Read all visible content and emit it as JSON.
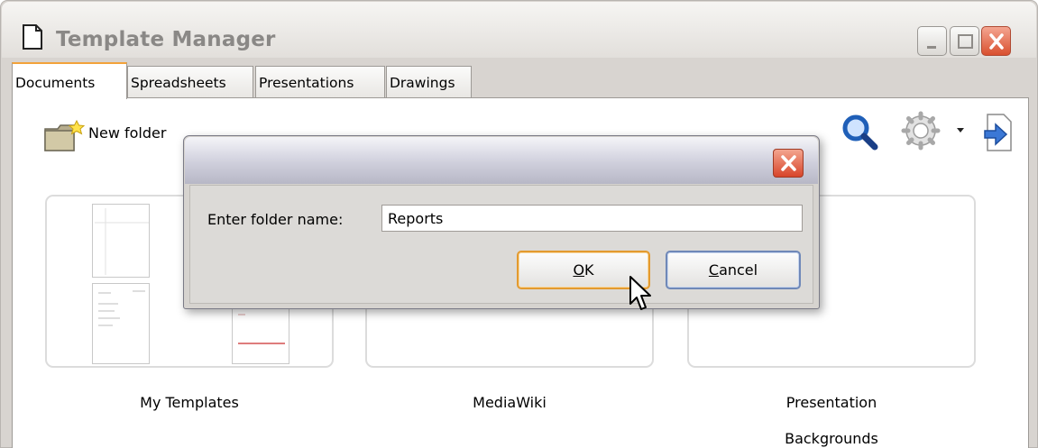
{
  "window": {
    "title": "Template Manager",
    "colors": {
      "close_button": "#d9502f",
      "active_tab_accent": "#f2a23a"
    }
  },
  "tabs": [
    {
      "label": "Documents",
      "active": true
    },
    {
      "label": "Spreadsheets",
      "active": false
    },
    {
      "label": "Presentations",
      "active": false
    },
    {
      "label": "Drawings",
      "active": false
    }
  ],
  "toolbar": {
    "new_folder_label": "New folder",
    "icons": [
      "new-folder-icon",
      "search-icon",
      "gear-icon",
      "dropdown-arrow-icon",
      "import-icon"
    ]
  },
  "folders": [
    {
      "label": "My Templates"
    },
    {
      "label": "MediaWiki"
    },
    {
      "label": "Presentation",
      "label_line2": "Backgrounds"
    }
  ],
  "dialog": {
    "prompt_label": "Enter folder name:",
    "folder_name_value": "Reports",
    "ok_label_mnemonic": "O",
    "ok_label_rest": "K",
    "cancel_label_mnemonic": "C",
    "cancel_label_rest": "ancel"
  }
}
